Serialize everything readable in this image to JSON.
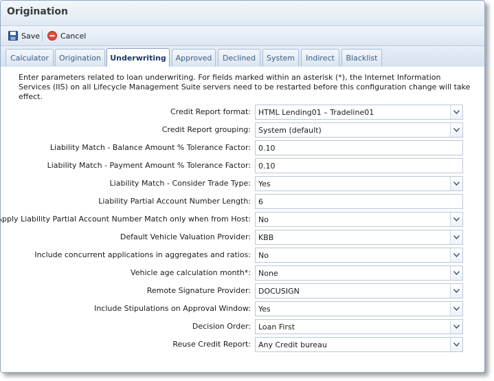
{
  "window": {
    "title": "Origination"
  },
  "toolbar": {
    "save_label": "Save",
    "cancel_label": "Cancel"
  },
  "tabs": [
    {
      "label": "Calculator"
    },
    {
      "label": "Origination"
    },
    {
      "label": "Underwriting",
      "active": true
    },
    {
      "label": "Approved"
    },
    {
      "label": "Declined"
    },
    {
      "label": "System"
    },
    {
      "label": "Indirect"
    },
    {
      "label": "Blacklist"
    }
  ],
  "description": "Enter parameters related to loan underwriting. For fields marked within an asterisk (*), the Internet Information Services (IIS) on all Lifecycle Management Suite servers need to be restarted before this configuration change will take effect.",
  "fields": [
    {
      "label": "Credit Report format:",
      "type": "select",
      "value": "HTML Lending01 – Tradeline01"
    },
    {
      "label": "Credit Report grouping:",
      "type": "select",
      "value": "System (default)"
    },
    {
      "label": "Liability Match - Balance Amount % Tolerance Factor:",
      "type": "text",
      "value": "0.10"
    },
    {
      "label": "Liability Match - Payment Amount % Tolerance Factor:",
      "type": "text",
      "value": "0.10"
    },
    {
      "label": "Liability Match - Consider Trade Type:",
      "type": "select",
      "value": "Yes"
    },
    {
      "label": "Liability Partial Account Number Length:",
      "type": "text",
      "value": "6"
    },
    {
      "label": "Apply Liability Partial Account Number Match only when from Host:",
      "type": "select",
      "value": "No"
    },
    {
      "label": "Default Vehicle Valuation Provider:",
      "type": "select",
      "value": "KBB"
    },
    {
      "label": "Include concurrent applications in aggregates and ratios:",
      "type": "select",
      "value": "No"
    },
    {
      "label": "Vehicle age calculation month*:",
      "type": "select",
      "value": "None"
    },
    {
      "label": "Remote Signature Provider:",
      "type": "select",
      "value": "DOCUSIGN"
    },
    {
      "label": "Include Stipulations on Approval Window:",
      "type": "select",
      "value": "Yes"
    },
    {
      "label": "Decision Order:",
      "type": "select",
      "value": "Loan First"
    },
    {
      "label": "Reuse Credit Report:",
      "type": "select",
      "value": "Any Credit bureau"
    }
  ],
  "colors": {
    "accent": "#3b5d86",
    "cancel_icon": "#e04b3c",
    "save_icon": "#2d5fa6"
  }
}
